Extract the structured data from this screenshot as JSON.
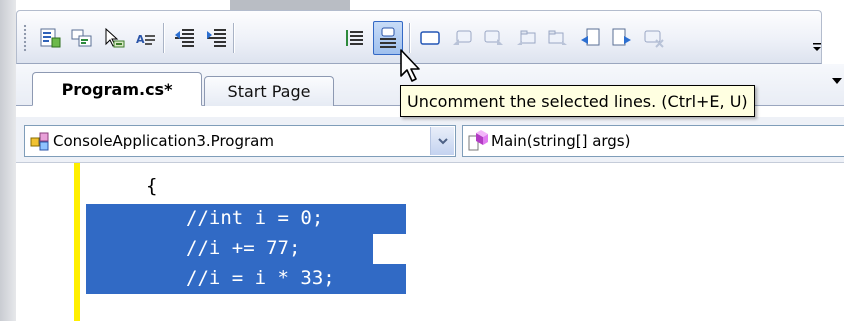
{
  "tabs": [
    {
      "label": "Program.cs*",
      "active": true
    },
    {
      "label": "Start Page",
      "active": false
    }
  ],
  "tooltip": {
    "text": "Uncomment the selected lines. (Ctrl+E, U)"
  },
  "navigation": {
    "class_combo": "ConsoleApplication3.Program",
    "member_combo": "Main(string[] args)"
  },
  "code": {
    "lines": [
      "{",
      "//int i = 0;",
      "//i += 77;",
      "//i = i * 33;"
    ]
  },
  "colors": {
    "selection": "#316ac5",
    "tooltip_bg": "#ffffe1",
    "margin_indicator": "#ffef00"
  },
  "toolbar_icons": [
    "object-members-icon",
    "parameter-info-icon",
    "quick-info-icon",
    "complete-word-icon",
    "decrease-indent-icon",
    "increase-indent-icon",
    "comment-lines-icon",
    "uncomment-lines-icon",
    "bookmark-icon",
    "previous-bookmark-icon",
    "next-bookmark-icon",
    "previous-bookmark-folder-icon",
    "next-bookmark-folder-icon",
    "previous-bookmark-document-icon",
    "next-bookmark-document-icon",
    "clear-bookmarks-icon"
  ]
}
